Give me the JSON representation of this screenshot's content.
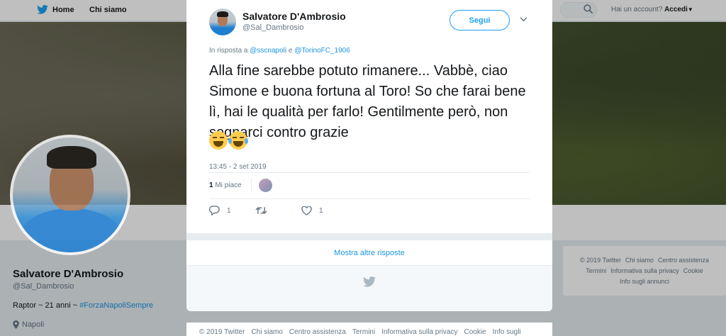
{
  "nav": {
    "home_label": "Home",
    "about_label": "Chi siamo",
    "account_prompt": "Hai un account?",
    "login_label": "Accedi"
  },
  "profile": {
    "name": "Salvatore D'Ambrosio",
    "handle": "@Sal_Dambrosio",
    "bio_prefix": "Raptor ~ 21 anni ~ ",
    "bio_hashtag": "#ForzaNapoliSempre",
    "location": "Napoli"
  },
  "tweet": {
    "author_name": "Salvatore D'Ambrosio",
    "author_handle": "@Sal_Dambrosio",
    "follow_label": "Segui",
    "reply_prefix": "In risposta a",
    "reply_mention_1": "@sscnapoli",
    "reply_joiner": "e",
    "reply_mention_2": "@TorinoFC_1906",
    "text": "Alla fine sarebbe potuto rimanere... Vabbè, ciao Simone e buona fortuna al Toro! So che farai bene lì, hai le qualità per farlo! Gentilmente però, non segnarci contro grazie",
    "emojis": [
      "laughing-face",
      "tears-of-joy-face"
    ],
    "timestamp": "13:45 - 2 set 2019",
    "likes_count": "1",
    "likes_label": "Mi piace",
    "reply_count": "1",
    "retweet_count": "",
    "like_count": "1",
    "more_replies_label": "Mostra altre risposte"
  },
  "right_footer": {
    "line1": [
      "© 2019 Twitter",
      "Chi siamo",
      "Centro assistenza"
    ],
    "line2": [
      "Termini",
      "Informativa sulla privacy",
      "Cookie"
    ],
    "line3": [
      "Info sugli annunci"
    ]
  },
  "bottom_footer": {
    "links": [
      "© 2019 Twitter",
      "Chi siamo",
      "Centro assistenza",
      "Termini",
      "Informativa sulla privacy",
      "Cookie",
      "Info sugli annunci"
    ]
  },
  "colors": {
    "accent": "#1da1f2",
    "link": "#1b95e0",
    "muted": "#657786"
  }
}
